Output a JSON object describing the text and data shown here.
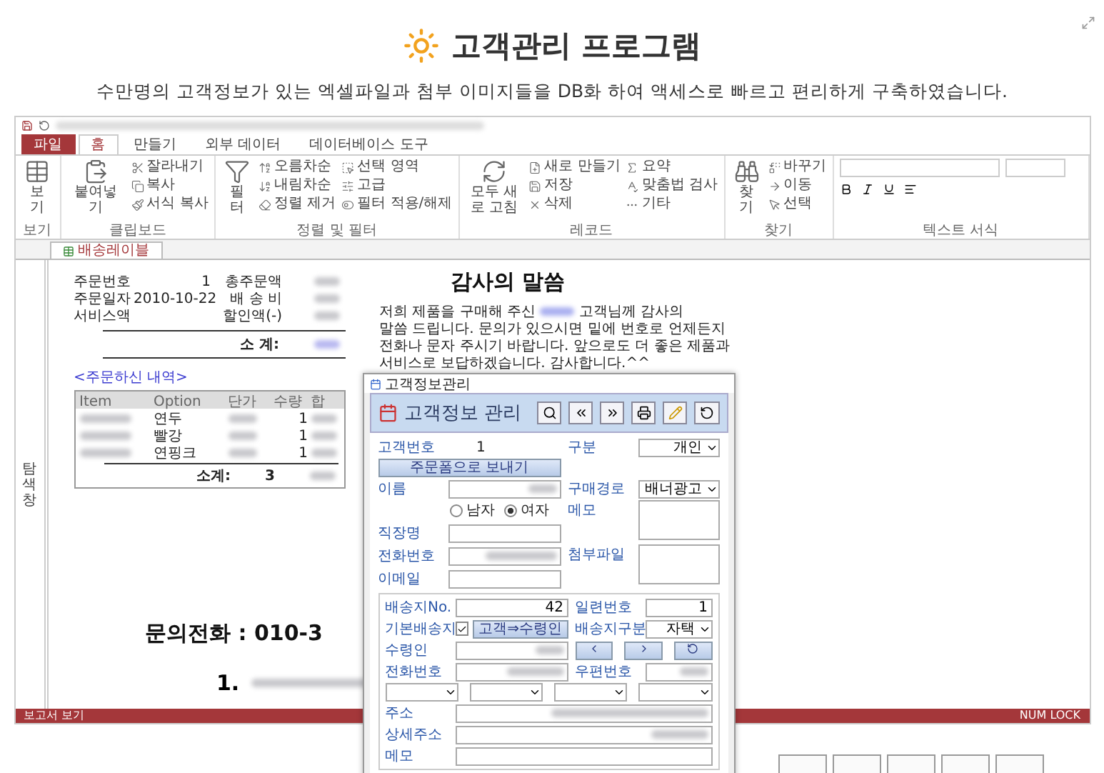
{
  "header": {
    "title": "고객관리 프로그램",
    "subtitle": "수만명의 고객정보가 있는 엑셀파일과 첨부 이미지들을 DB화 하여 액세스로 빠르고 편리하게 구축하였습니다."
  },
  "ribbon": {
    "tabs": [
      {
        "label": "파일",
        "selected": false,
        "kind": "file"
      },
      {
        "label": "홈",
        "selected": true,
        "kind": "tab"
      },
      {
        "label": "만들기",
        "selected": false,
        "kind": "tab"
      },
      {
        "label": "외부 데이터",
        "selected": false,
        "kind": "tab"
      },
      {
        "label": "데이터베이스 도구",
        "selected": false,
        "kind": "tab"
      }
    ],
    "groups": [
      {
        "label": "보기",
        "columns": [
          {
            "kind": "large",
            "commands": [
              "보기"
            ]
          }
        ]
      },
      {
        "label": "클립보드",
        "columns": [
          {
            "kind": "large",
            "commands": [
              "붙여넣기"
            ]
          },
          {
            "kind": "small",
            "commands": [
              "잘라내기",
              "복사",
              "서식 복사"
            ]
          }
        ]
      },
      {
        "label": "정렬 및 필터",
        "columns": [
          {
            "kind": "large",
            "commands": [
              "필터"
            ]
          },
          {
            "kind": "small",
            "commands": [
              "오름차순",
              "내림차순",
              "정렬 제거"
            ]
          },
          {
            "kind": "small",
            "commands": [
              "선택 영역",
              "고급",
              "필터 적용/해제"
            ]
          }
        ]
      },
      {
        "label": "레코드",
        "columns": [
          {
            "kind": "large",
            "commands": [
              "모두 새로 고침"
            ]
          },
          {
            "kind": "small",
            "commands": [
              "새로 만들기",
              "저장",
              "삭제"
            ]
          },
          {
            "kind": "small",
            "commands": [
              "요약",
              "맞춤법 검사",
              "기타"
            ]
          }
        ]
      },
      {
        "label": "찾기",
        "columns": [
          {
            "kind": "large",
            "commands": [
              "찾기"
            ]
          },
          {
            "kind": "small",
            "commands": [
              "바꾸기",
              "이동",
              "선택"
            ]
          }
        ]
      },
      {
        "label": "텍스트 서식",
        "columns": [
          {
            "kind": "format"
          }
        ]
      }
    ]
  },
  "document_tab": "배송레이블",
  "nav_pane": "탐색 창",
  "report": {
    "order_info": [
      {
        "label": "주문번호",
        "value": "1",
        "label_2": "총주문액"
      },
      {
        "label": "주문일자",
        "value": "2010-10-22",
        "label_2": "배 송 비"
      },
      {
        "label": "서비스액",
        "label_2": "할인액(-)"
      }
    ],
    "subtotal_label": "소 계:",
    "items_title": "<주문하신 내역>",
    "columns": [
      "Item",
      "Option",
      "단가",
      "수량",
      "합"
    ],
    "rows": [
      {
        "option": "연두",
        "qty": "1"
      },
      {
        "option": "빨강",
        "qty": "1"
      },
      {
        "option": "연핑크",
        "qty": "1"
      }
    ],
    "total_label": "소계:",
    "total_qty": "3",
    "thanks_title": "감사의 말씀",
    "thanks_lines": [
      "저희 제품을 구매해 주신",
      "고객님께 감사의",
      "말씀 드립니다. 문의가 있으시면 밑에 번호로 언제든지",
      "전화나 문자 주시기 바랍니다. 앞으로도 더 좋은 제품과",
      "서비스로 보답하겠습니다. 감사합니다.^^"
    ],
    "contact": "문의전화 : 010-3",
    "step": "1."
  },
  "dialog": {
    "title": "고객정보관리",
    "heading": "고객정보 관리",
    "customer_no_label": "고객번호",
    "customer_no": "1",
    "type_label": "구분",
    "type": "개인",
    "send_button": "주문폼으로 보내기",
    "name_label": "이름",
    "source_label": "구매경로",
    "source": "배너광고",
    "genders": [
      {
        "label": "남자",
        "selected": false
      },
      {
        "label": "여자",
        "selected": true
      }
    ],
    "memo_label": "메모",
    "company_label": "직장명",
    "phone_label": "전화번호",
    "attach_label": "첨부파일",
    "email_label": "이메일",
    "ship_no_label": "배송지No.",
    "ship_no": "42",
    "serial_label": "일련번호",
    "serial": "1",
    "default_label": "기본배송지",
    "default_checked": true,
    "copy_button": "고객⇒수령인",
    "ship_type_label": "배송지구분",
    "ship_type": "자택",
    "receiver_label": "수령인",
    "ship_phone_label": "전화번호",
    "zip_label": "우편번호",
    "address_label": "주소",
    "detail_label": "상세주소",
    "ship_memo_label": "메모"
  },
  "status_bar": {
    "left": "보고서 보기",
    "right": "NUM LOCK"
  }
}
